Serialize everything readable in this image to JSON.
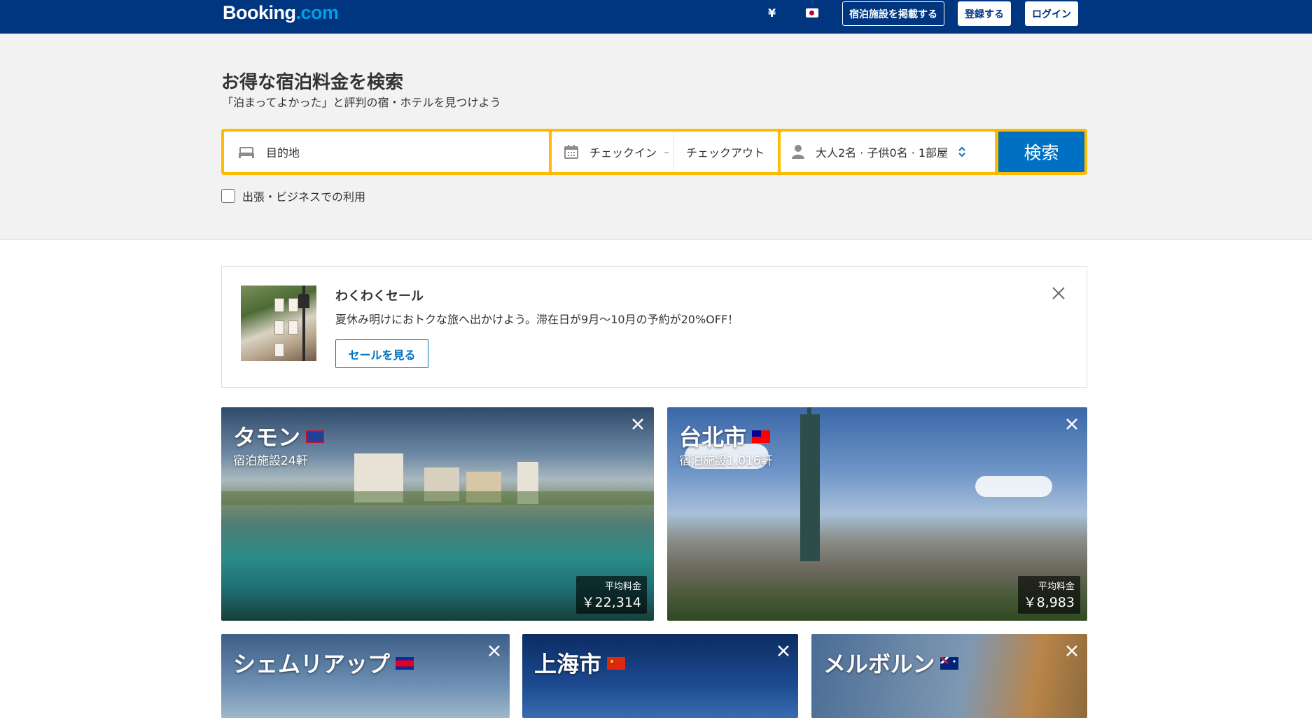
{
  "header": {
    "logo_main": "Booking",
    "logo_suffix": ".com",
    "currency": "¥",
    "list_property": "宿泊施設を掲載する",
    "register": "登録する",
    "login": "ログイン"
  },
  "hero": {
    "title": "お得な宿泊料金を検索",
    "subtitle": "「泊まってよかった」と評判の宿・ホテルを見つけよう"
  },
  "search": {
    "destination_placeholder": "目的地",
    "checkin": "チェックイン",
    "separator": "–",
    "checkout": "チェックアウト",
    "guests": "大人2名 · 子供0名 · 1部屋",
    "button": "検索",
    "business_label": "出張・ビジネスでの利用"
  },
  "promo": {
    "title": "わくわくセール",
    "text": "夏休み明けにおトクな旅へ出かけよう。滞在日が9月〜10月の予約が20%OFF！",
    "button": "セールを見る"
  },
  "destinations": [
    {
      "name": "タモン",
      "count": "宿泊施設24軒",
      "price_label": "平均料金",
      "price": "￥22,314",
      "flag": "guam-flag"
    },
    {
      "name": "台北市",
      "count": "宿泊施設1,016軒",
      "price_label": "平均料金",
      "price": "￥8,983",
      "flag": "taiwan-flag"
    },
    {
      "name": "シェムリアップ",
      "flag": "cambodia-flag"
    },
    {
      "name": "上海市",
      "flag": "china-flag"
    },
    {
      "name": "メルボルン",
      "flag": "australia-flag"
    }
  ],
  "colors": {
    "brand": "#003580",
    "accent": "#0071c2",
    "search_border": "#febb02"
  }
}
